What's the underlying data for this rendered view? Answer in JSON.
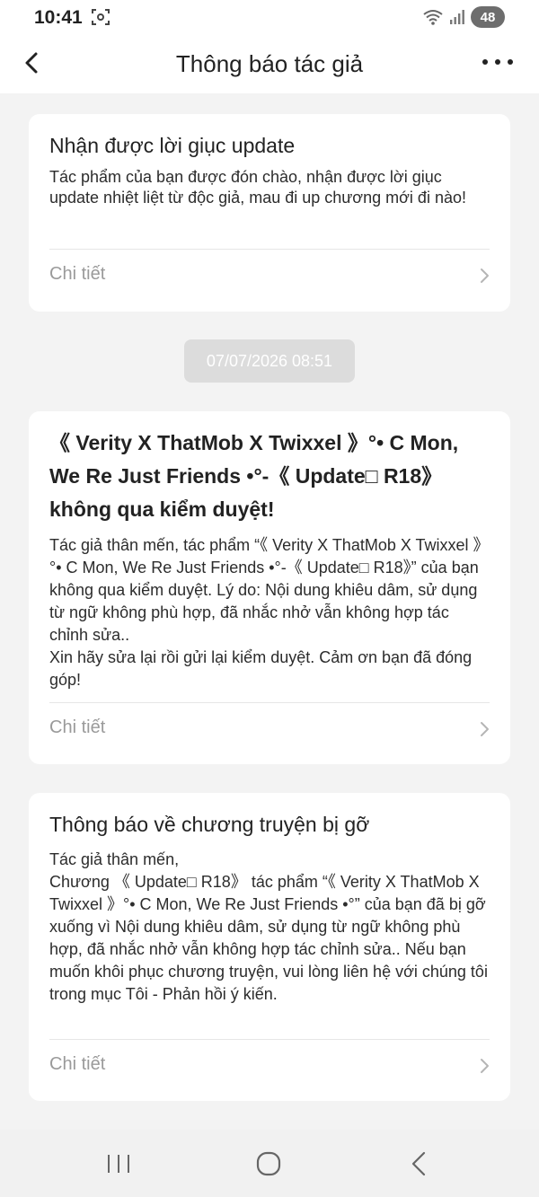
{
  "status_bar": {
    "time": "10:41",
    "battery": "48"
  },
  "header": {
    "title": "Thông báo tác giả"
  },
  "notifications": [
    {
      "title": "Nhận được lời giục update",
      "body": "Tác phẩm của bạn được đón chào, nhận được lời giục update nhiệt liệt từ độc giả, mau đi up chương mới đi nào!",
      "detail_label": "Chi tiết"
    },
    {
      "timestamp": "07/07/2026 08:51",
      "title": "《 Verity X ThatMob X Twixxel 》°• C Mon, We Re Just Friends •°-《 Update□ R18》 không qua kiểm duyệt!",
      "body": "Tác giả thân mến, tác phẩm “《 Verity X ThatMob X Twixxel 》°• C Mon, We Re Just Friends •°-《 Update□ R18》” của bạn không qua kiểm duyệt. Lý do: Nội dung khiêu dâm, sử dụng từ ngữ không phù hợp, đã nhắc nhở vẫn không hợp tác chỉnh sửa..\nXin hãy sửa lại rồi gửi lại kiểm duyệt. Cảm ơn bạn đã đóng góp!",
      "detail_label": "Chi tiết"
    },
    {
      "title": "Thông báo về chương truyện bị gỡ",
      "body": "Tác giả thân mến,\nChương 《 Update□ R18》 tác phẩm “《 Verity X ThatMob X Twixxel 》°• C Mon, We Re Just Friends •°” của bạn đã bị gỡ xuống vì Nội dung khiêu dâm, sử dụng từ ngữ không phù hợp, đã nhắc nhở vẫn không hợp tác chỉnh sửa.. Nếu bạn muốn khôi phục chương truyện, vui lòng liên hệ với chúng tôi trong mục Tôi - Phản hồi ý kiến.",
      "detail_label": "Chi tiết"
    }
  ],
  "colors": {
    "background": "#f3f3f3",
    "card": "#ffffff",
    "muted_text": "#9a9a9a",
    "timestamp_bg": "#dcdcdc"
  }
}
